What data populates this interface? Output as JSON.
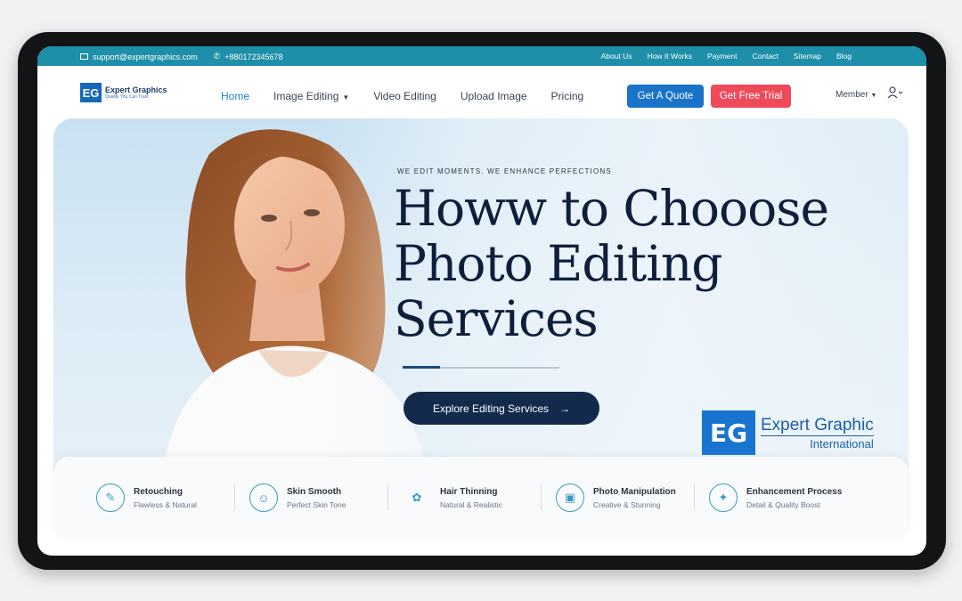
{
  "topbar": {
    "email": "support@expertgraphics.com",
    "phone": "+880172345678",
    "links": [
      "About Us",
      "How It Works",
      "Payment",
      "Contact",
      "Sitemap",
      "Blog"
    ]
  },
  "nav": {
    "logo_mark": "EG",
    "logo_name": "Expert Graphics",
    "logo_tagline": "Quality You Can Trust",
    "menu": [
      "Home",
      "Image Editing",
      "Video Editing",
      "Upload Image",
      "Pricing"
    ],
    "quote_button": "Get A Quote",
    "trial_button": "Get Free Trial",
    "member_label": "Member"
  },
  "hero": {
    "eyebrow": "WE EDIT MOMENTS. WE ENHANCE PERFECTIONS",
    "headline_line1": "Howw to Chooose",
    "headline_line2": "Photo Editing",
    "headline_line3": "Services",
    "cta": "Explore Editing Services",
    "brand_mark": "EG",
    "brand_name": "Expert Graphic",
    "brand_sub": "International"
  },
  "features": [
    {
      "title": "Retouching",
      "subtitle": "Flawless & Natural",
      "icon": "brush-icon"
    },
    {
      "title": "Skin Smooth",
      "subtitle": "Perfect Skin Tone",
      "icon": "face-icon"
    },
    {
      "title": "Hair Thinning",
      "subtitle": "Natural & Realistic",
      "icon": "hair-icon"
    },
    {
      "title": "Photo Manipulation",
      "subtitle": "Creative & Stunning",
      "icon": "image-edit-icon"
    },
    {
      "title": "Enhancement Process",
      "subtitle": "Detail & Quality Boost",
      "icon": "sparkle-icon"
    }
  ],
  "colors": {
    "topbar": "#1d8fa8",
    "quote_button": "#1873c9",
    "trial_button": "#ef4a5a",
    "cta_button": "#132a4d",
    "headline": "#0f1f3b"
  }
}
